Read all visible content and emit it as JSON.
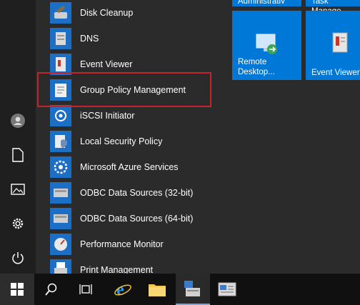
{
  "apps": [
    {
      "label": "Disk Cleanup",
      "icon": "disk-cleanup-icon"
    },
    {
      "label": "DNS",
      "icon": "dns-icon"
    },
    {
      "label": "Event Viewer",
      "icon": "event-viewer-icon"
    },
    {
      "label": "Group Policy Management",
      "icon": "group-policy-icon"
    },
    {
      "label": "iSCSI Initiator",
      "icon": "iscsi-icon"
    },
    {
      "label": "Local Security Policy",
      "icon": "security-policy-icon"
    },
    {
      "label": "Microsoft Azure Services",
      "icon": "azure-icon"
    },
    {
      "label": "ODBC Data Sources (32-bit)",
      "icon": "odbc-icon"
    },
    {
      "label": "ODBC Data Sources (64-bit)",
      "icon": "odbc-icon"
    },
    {
      "label": "Performance Monitor",
      "icon": "performance-monitor-icon"
    },
    {
      "label": "Print Management",
      "icon": "printer-icon"
    }
  ],
  "tiles": {
    "top_left": "Administrativ",
    "top_right": "Task Manage",
    "remote_desktop": "Remote\nDesktop...",
    "event_viewer": "Event Viewer"
  },
  "colors": {
    "tile_blue": "#0078d7",
    "highlight_red": "#c0262b"
  }
}
